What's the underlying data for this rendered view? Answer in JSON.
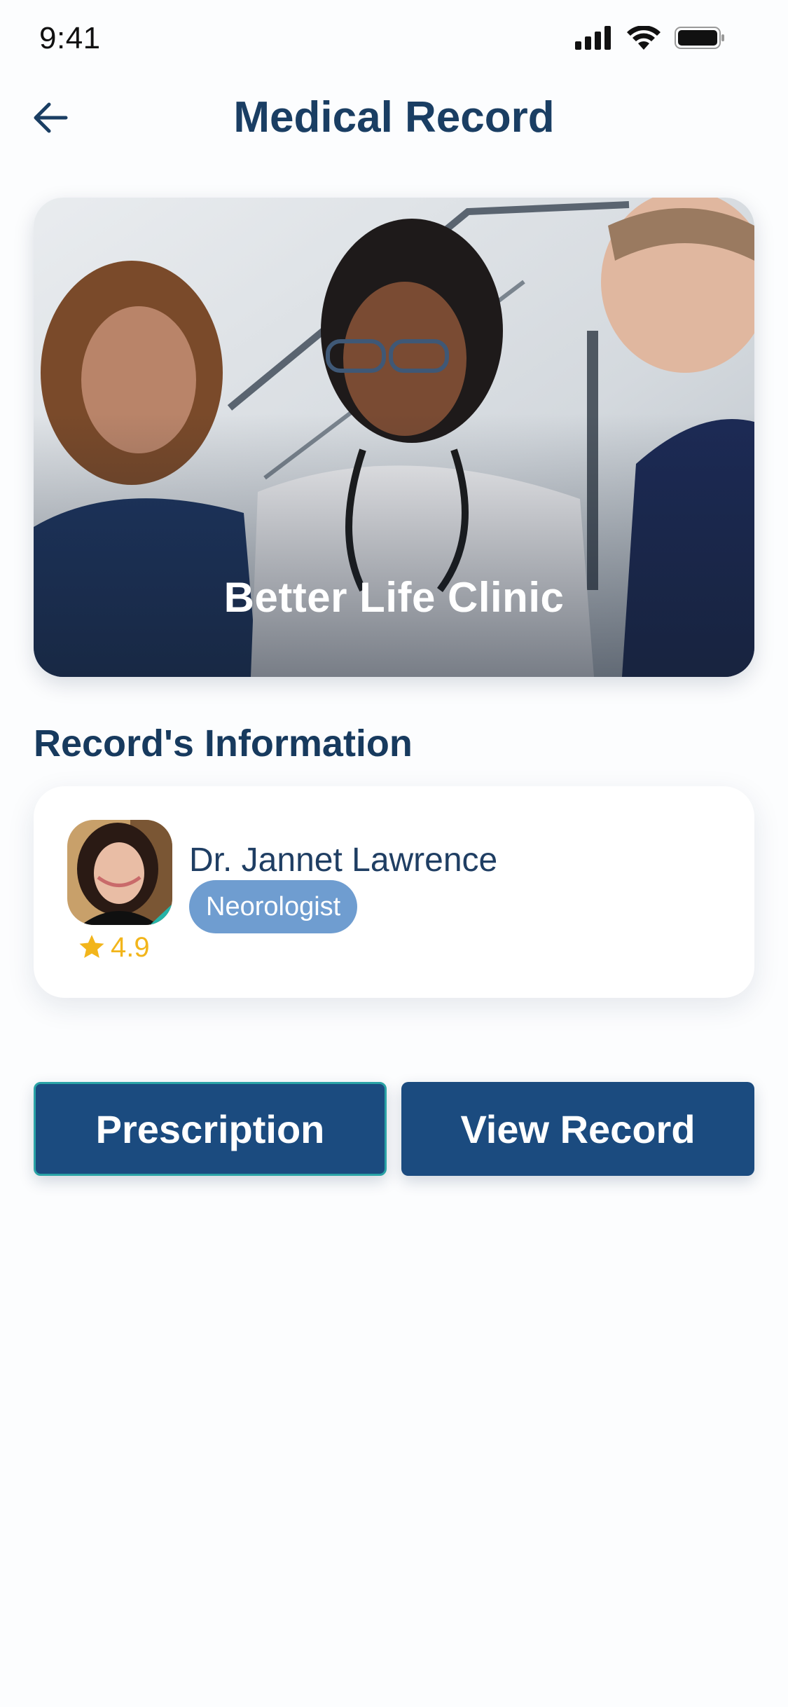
{
  "status_bar": {
    "time": "9:41",
    "icons": [
      "cellular-signal-icon",
      "wifi-icon",
      "battery-icon"
    ]
  },
  "header": {
    "title": "Medical Record",
    "back_icon": "arrow-left-icon"
  },
  "hero": {
    "clinic_name": "Better Life Clinic"
  },
  "record_info": {
    "section_title": "Record's Information",
    "doctor": {
      "name": "Dr. Jannet Lawrence",
      "specialty": "Neorologist",
      "rating": "4.9",
      "rating_icon": "star-icon"
    }
  },
  "actions": {
    "prescription_label": "Prescription",
    "view_record_label": "View Record"
  },
  "colors": {
    "primary": "#1b4b7f",
    "title": "#1a3e63",
    "badge": "#6f9dd0",
    "rating": "#f2b51b",
    "accent_border": "#2aa3a6"
  }
}
